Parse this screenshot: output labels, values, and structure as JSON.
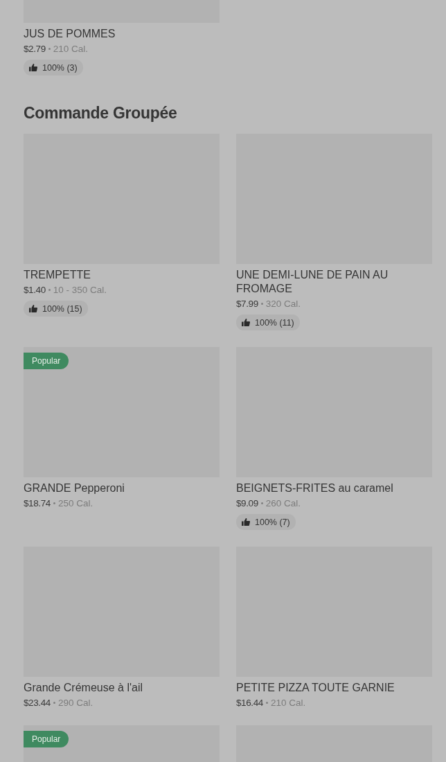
{
  "sections": [
    {
      "items": [
        {
          "image": {
            "kind": "picture"
          },
          "name": "JUS DE POMMES",
          "price": "$2.79",
          "calories": "210 Cal.",
          "rating": "100% (3)"
        }
      ]
    },
    {
      "title": "Commande Groupée",
      "items": [
        {
          "image": {
            "kind": "picture"
          },
          "name": "TREMPETTE",
          "price": "$1.40",
          "calories": "10 - 350 Cal.",
          "rating": "100% (15)"
        },
        {
          "image": {
            "kind": "picture"
          },
          "name": "UNE DEMI-LUNE DE PAIN AU FROMAGE",
          "price": "$7.99",
          "calories": "320 Cal.",
          "rating": "100% (11)"
        },
        {
          "image": {
            "kind": "picture"
          },
          "badge": "Popular",
          "name": "GRANDE Pepperoni",
          "price": "$18.74",
          "calories": "250 Cal."
        },
        {
          "image": {
            "kind": "picture"
          },
          "name": "BEIGNETS-FRITES au caramel",
          "price": "$9.09",
          "calories": "260 Cal.",
          "rating": "100% (7)"
        },
        {
          "image": {
            "kind": "picture"
          },
          "name": "Grande Crémeuse à l'ail",
          "price": "$23.44",
          "calories": "290 Cal."
        },
        {
          "image": {
            "kind": "picture"
          },
          "name": "PETITE PIZZA TOUTE GARNIE",
          "price": "$16.44",
          "calories": "210 Cal."
        },
        {
          "image": {
            "kind": "picture"
          },
          "badge": "Popular"
        },
        {
          "image": {
            "kind": "picture"
          }
        }
      ]
    }
  ]
}
